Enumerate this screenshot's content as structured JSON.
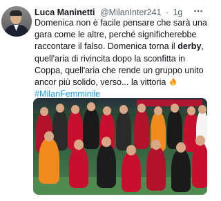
{
  "tweet": {
    "author_name": "Luca Maninetti",
    "author_handle": "@MilanInter241",
    "separator": "·",
    "time": "1g",
    "text_part1": "Domenica non è facile pensare che sarà una gara come le altre, perché significherebbe raccontare il falso. Domenica torna il ",
    "text_bold": "derby",
    "text_part2": ", quell'aria di rivincita dopo la sconfitta in Coppa, quell'aria che rende un gruppo unito ancor più solido, verso... la vittoria ",
    "hashtag": "#MilanFemminile"
  },
  "icons": {
    "more": "more-horizontal-icon",
    "emoji": "fire-emoji-icon"
  },
  "colors": {
    "hashtag": "#1d9bf0",
    "secondary_text": "#536471",
    "milan_red": "#c8102e",
    "keeper_orange": "#f28a1c"
  }
}
